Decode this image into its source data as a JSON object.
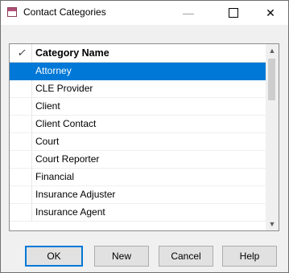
{
  "window": {
    "title": "Contact Categories",
    "minimize_glyph": "—",
    "close_glyph": "✕",
    "title_icon": "window-app-icon"
  },
  "list": {
    "header_check": "✓",
    "header_name": "Category Name",
    "selected_index": 0,
    "rows": [
      "Attorney",
      "CLE Provider",
      "Client",
      "Client Contact",
      "Court",
      "Court Reporter",
      "Financial",
      "Insurance Adjuster",
      "Insurance Agent"
    ],
    "scroll_up_glyph": "▲",
    "scroll_down_glyph": "▼"
  },
  "buttons": {
    "ok": "OK",
    "new": "New",
    "cancel": "Cancel",
    "help": "Help"
  },
  "colors": {
    "selection": "#0078d7",
    "window_bg": "#f0f0f0",
    "focus_border": "#0078d7"
  }
}
